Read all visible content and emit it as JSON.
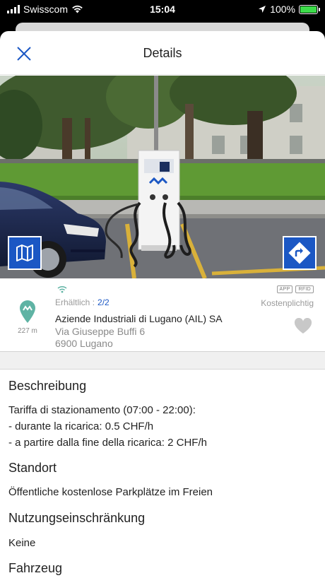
{
  "status_bar": {
    "carrier": "Swisscom",
    "time": "15:04",
    "battery": "100%"
  },
  "nav": {
    "title": "Details"
  },
  "station": {
    "availability_label": "Erhältlich :",
    "availability_value": "2/2",
    "badges": [
      "APP",
      "RFID"
    ],
    "cost": "Kostenplichtig",
    "distance": "227 m",
    "operator": "Aziende Industriali di Lugano (AIL) SA",
    "street": "Via Giuseppe Buffi 6",
    "city": "6900 Lugano"
  },
  "sections": {
    "description_title": "Beschreibung",
    "description_lines": [
      "Tariffa di stazionamento (07:00 - 22:00):",
      "- durante la ricarica: 0.5 CHF/h",
      "- a partire dalla fine della ricarica: 2 CHF/h"
    ],
    "location_title": "Standort",
    "location_text": "Öffentliche kostenlose Parkplätze im Freien",
    "restriction_title": "Nutzungseinschränkung",
    "restriction_text": "Keine",
    "vehicle_title": "Fahrzeug"
  },
  "colors": {
    "accent": "#1b57c4",
    "pin": "#5fb3a4",
    "heart": "#c8c8c8"
  }
}
